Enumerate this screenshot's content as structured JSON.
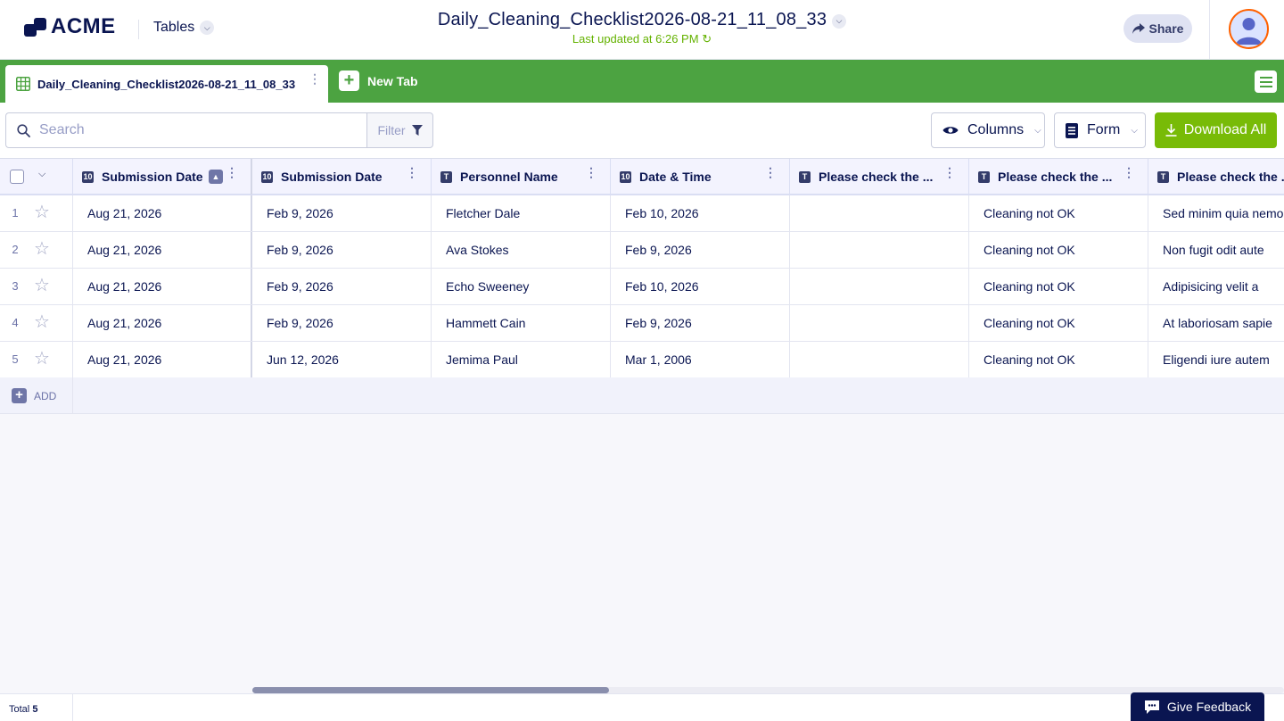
{
  "header": {
    "brand": "ACME",
    "tables_label": "Tables",
    "doc_title": "Daily_Cleaning_Checklist2026-08-21_11_08_33",
    "last_updated": "Last updated at 6:26 PM",
    "share_label": "Share"
  },
  "tabs": {
    "active_label": "Daily_Cleaning_Checklist2026-08-21_11_08_33",
    "new_tab_label": "New Tab"
  },
  "toolbar": {
    "search_placeholder": "Search",
    "filter_label": "Filter",
    "columns_label": "Columns",
    "form_label": "Form",
    "download_label": "Download All"
  },
  "table": {
    "columns": [
      {
        "label": "Submission Date",
        "icon": "calendar-icon"
      },
      {
        "label": "Submission Date",
        "icon": "calendar-icon"
      },
      {
        "label": "Personnel Name",
        "icon": "text-icon"
      },
      {
        "label": "Date & Time",
        "icon": "calendar-icon"
      },
      {
        "label": "Please check the ...",
        "icon": "text-icon"
      },
      {
        "label": "Please check the ...",
        "icon": "text-icon"
      },
      {
        "label": "Please check the ...",
        "icon": "text-icon"
      }
    ],
    "rows": [
      {
        "num": "1",
        "cells": [
          "Aug 21, 2026",
          "Feb 9, 2026",
          "Fletcher Dale",
          "Feb 10, 2026",
          "",
          "Cleaning not OK",
          "Sed minim quia nemo"
        ]
      },
      {
        "num": "2",
        "cells": [
          "Aug 21, 2026",
          "Feb 9, 2026",
          "Ava Stokes",
          "Feb 9, 2026",
          "",
          "Cleaning not OK",
          "Non fugit odit aute"
        ]
      },
      {
        "num": "3",
        "cells": [
          "Aug 21, 2026",
          "Feb 9, 2026",
          "Echo Sweeney",
          "Feb 10, 2026",
          "",
          "Cleaning not OK",
          "Adipisicing velit a"
        ]
      },
      {
        "num": "4",
        "cells": [
          "Aug 21, 2026",
          "Feb 9, 2026",
          "Hammett Cain",
          "Feb 9, 2026",
          "",
          "Cleaning not OK",
          "At laboriosam sapie"
        ]
      },
      {
        "num": "5",
        "cells": [
          "Aug 21, 2026",
          "Jun 12, 2026",
          "Jemima Paul",
          "Mar 1, 2006",
          "",
          "Cleaning not OK",
          "Eligendi iure autem"
        ]
      }
    ],
    "add_label": "ADD"
  },
  "footer": {
    "total_label": "Total",
    "total_count": "5",
    "feedback_label": "Give Feedback"
  },
  "colors": {
    "brand_navy": "#0a1551",
    "tab_bar_green": "#4ca341",
    "download_green": "#78bb07",
    "updated_green": "#64b200",
    "avatar_ring": "#ff6100"
  }
}
